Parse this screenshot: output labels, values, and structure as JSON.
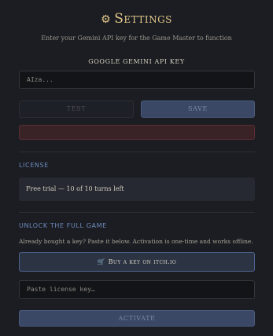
{
  "header": {
    "title": "Settings",
    "subtitle": "Enter your Gemini API key for the Game Master to function"
  },
  "api_key": {
    "section_label": "GOOGLE GEMINI API KEY",
    "placeholder": "AIza...",
    "test_label": "TEST",
    "save_label": "SAVE"
  },
  "license": {
    "section_label": "LICENSE",
    "status": "Free trial — 10 of 10 turns left"
  },
  "unlock": {
    "section_label": "UNLOCK THE FULL GAME",
    "info": "Already bought a key? Paste it below. Activation is one-time and works offline.",
    "buy_label": "Buy a key on itch.io",
    "license_placeholder": "Paste license key…",
    "activate_label": "ACTIVATE"
  },
  "icons": {
    "gear": "gear-icon",
    "cart": "cart-icon"
  },
  "colors": {
    "accent_gold": "#e3c98a",
    "section_blue": "#6e8cc0",
    "button_blue": "#3a4866",
    "error_red": "#3a2326"
  }
}
